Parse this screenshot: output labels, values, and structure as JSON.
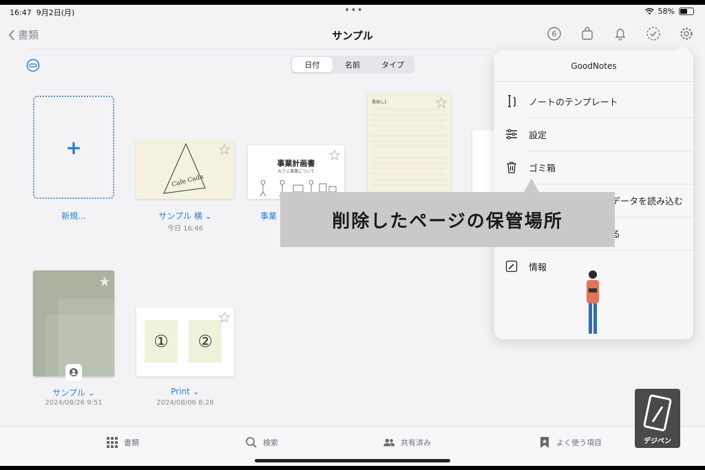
{
  "status": {
    "time": "16:47",
    "date": "9月2日(月)",
    "battery": "58%",
    "battery_level": 0.58
  },
  "nav": {
    "back_label": "書類",
    "title": "サンプル",
    "notification_count": "6"
  },
  "segment": {
    "items": [
      "日付",
      "名前",
      "タイプ"
    ],
    "active": 0
  },
  "docs": {
    "new_label": "新規...",
    "sample_landscape_label": "サンプル 横",
    "sample_landscape_date": "今日 16:46",
    "business_label": "事業",
    "business_title": "事業計画書",
    "business_subtitle": "カフェ事業について",
    "sample_label": "サンプル",
    "sample_date": "2024/08/26 9:51",
    "print_label": "Print",
    "print_date": "2024/08/06 8:28",
    "paper_heading": "見出し1",
    "circle_1": "①",
    "circle_2": "②",
    "triangle_text": "Cafe Cada"
  },
  "popover": {
    "title": "GoodNotes",
    "items": [
      {
        "label": "ノートのテンプレート",
        "icon": "template-icon"
      },
      {
        "label": "設定",
        "icon": "sliders-icon"
      },
      {
        "label": "ゴミ箱",
        "icon": "trash-icon"
      },
      {
        "label": "データを読み込む",
        "icon": "import-icon"
      },
      {
        "label": "る",
        "icon": "share-icon"
      },
      {
        "label": "情報",
        "icon": "info-icon"
      }
    ]
  },
  "caption": "削除したページの保管場所",
  "tabs": [
    {
      "label": "書類",
      "icon": "grid-icon"
    },
    {
      "label": "検索",
      "icon": "search-icon"
    },
    {
      "label": "共有済み",
      "icon": "people-icon"
    },
    {
      "label": "よく使う項目",
      "icon": "bookmark-icon"
    }
  ],
  "logo_text": "デジペン",
  "colors": {
    "accent": "#2b7fd1",
    "background": "#f3f3f5"
  }
}
